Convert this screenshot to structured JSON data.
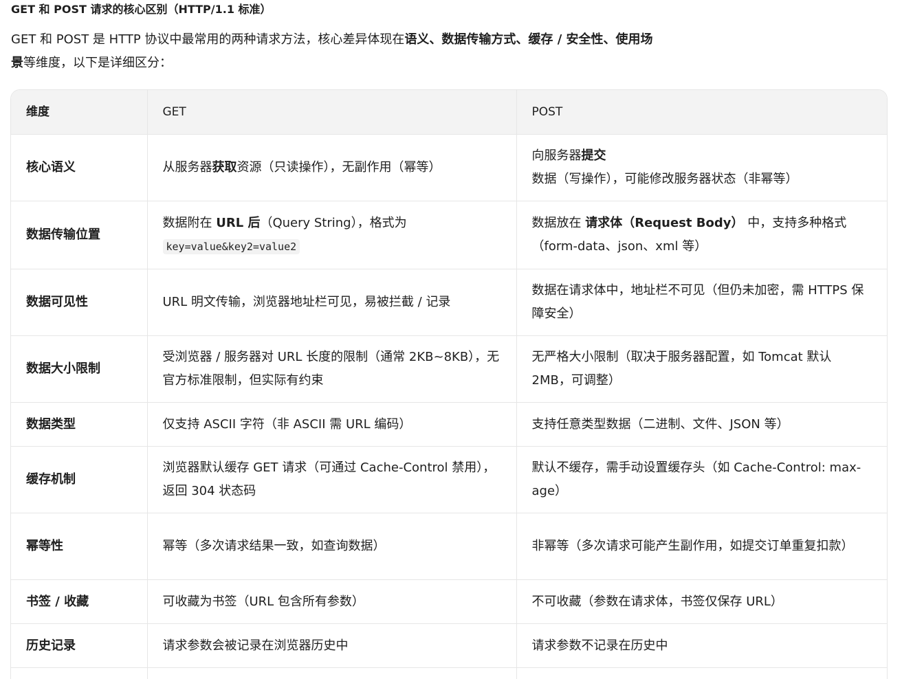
{
  "title": "GET 和 POST 请求的核心区别（HTTP/1.1 标准）",
  "intro": {
    "part1": "GET 和 POST 是 HTTP 协议中最常用的两种请求方法，核心差异体现在",
    "bold": "语义、数据传输方式、缓存 / 安全性、使用场景",
    "part2": "等维度，以下是详细区分："
  },
  "table": {
    "headers": [
      "维度",
      "GET",
      "POST"
    ],
    "rows": [
      {
        "dim": "核心语义",
        "get_pre": "从服务器",
        "get_bold": "获取",
        "get_post": "资源（只读操作），无副作用（幂等）",
        "post_pre": "向服务器",
        "post_bold": "提交",
        "post_post": "数据（写操作），可能修改服务器状态（非幂等）"
      },
      {
        "dim": "数据传输位置",
        "get_pre": "数据附在 ",
        "get_bold": "URL 后",
        "get_post": "（Query String），格式为 ",
        "get_code": "key=value&key2=value2",
        "post_pre": "数据放在 ",
        "post_bold": "请求体（Request Body）",
        "post_post": " 中，支持多种格式（form-data、json、xml 等）"
      },
      {
        "dim": "数据可见性",
        "get": "URL 明文传输，浏览器地址栏可见，易被拦截 / 记录",
        "post": "数据在请求体中，地址栏不可见（但仍未加密，需 HTTPS 保障安全）"
      },
      {
        "dim": "数据大小限制",
        "get": "受浏览器 / 服务器对 URL 长度的限制（通常 2KB~8KB），无官方标准限制，但实际有约束",
        "post": "无严格大小限制（取决于服务器配置，如 Tomcat 默认 2MB，可调整）"
      },
      {
        "dim": "数据类型",
        "get": "仅支持 ASCII 字符（非 ASCII 需 URL 编码）",
        "post": "支持任意类型数据（二进制、文件、JSON 等）"
      },
      {
        "dim": "缓存机制",
        "get": "浏览器默认缓存 GET 请求（可通过 Cache-Control 禁用），返回 304 状态码",
        "post": "默认不缓存，需手动设置缓存头（如 Cache-Control: max-age）"
      },
      {
        "dim": "幂等性",
        "get": "幂等（多次请求结果一致，如查询数据）",
        "post": "非幂等（多次请求可能产生副作用，如提交订单重复扣款）"
      },
      {
        "dim": "书签 / 收藏",
        "get": "可收藏为书签（URL 包含所有参数）",
        "post": "不可收藏（参数在请求体，书签仅保存 URL）"
      },
      {
        "dim": "历史记录",
        "get": "请求参数会被记录在浏览器历史中",
        "post": "请求参数不记录在历史中"
      }
    ]
  }
}
